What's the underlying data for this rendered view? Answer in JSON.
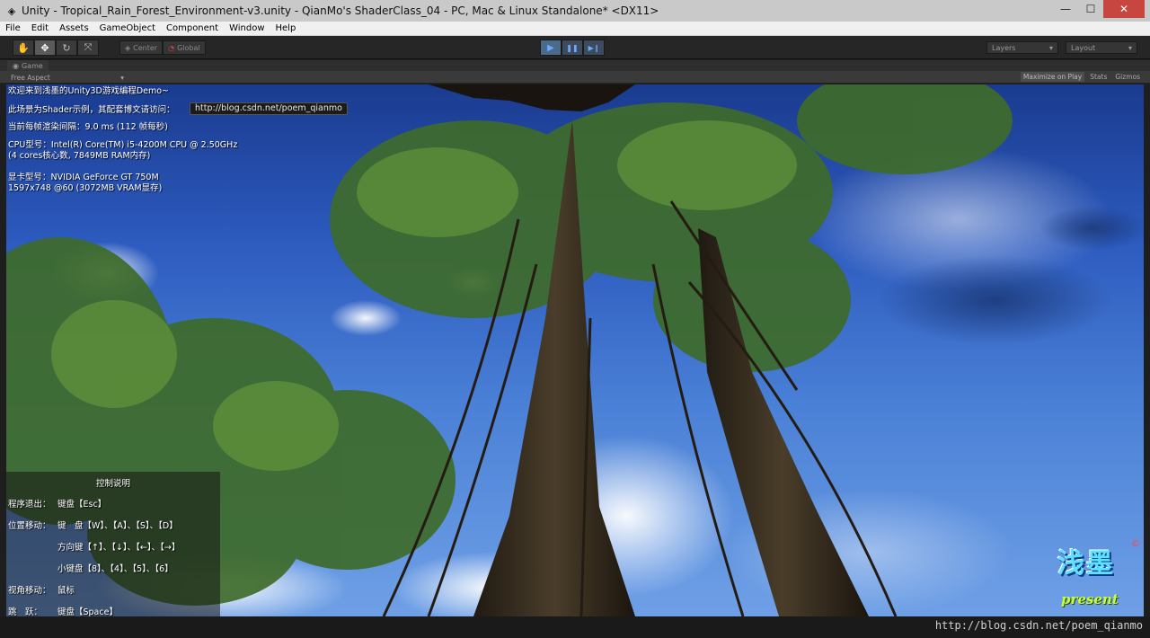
{
  "window": {
    "title": "Unity - Tropical_Rain_Forest_Environment-v3.unity - QianMo's ShaderClass_04 - PC, Mac & Linux Standalone* <DX11>",
    "controls": {
      "minimize": "—",
      "maximize": "☐",
      "close": "✕"
    }
  },
  "menu": [
    "File",
    "Edit",
    "Assets",
    "GameObject",
    "Component",
    "Window",
    "Help"
  ],
  "toolbar": {
    "transform_tools": [
      "hand-icon",
      "move-icon",
      "rotate-icon",
      "scale-icon"
    ],
    "pivot": {
      "center": "Center",
      "global": "Global"
    },
    "playback": {
      "play": "▶",
      "pause": "❚❚",
      "step": "▶❙"
    },
    "layers": "Layers",
    "layout": "Layout"
  },
  "game_panel": {
    "tab_label": "Game",
    "aspect": "Free Aspect",
    "maximize_on_play": "Maximize on Play",
    "stats": "Stats",
    "gizmos": "Gizmos"
  },
  "hud": {
    "welcome": "欢迎来到浅墨的Unity3D游戏编程Demo~",
    "shader_intro": "此场景为Shader示例，其配套博文请访问：",
    "url": "http://blog.csdn.net/poem_qianmo",
    "frame_time": "当前每帧渲染间隔：9.0 ms (112 帧每秒)",
    "cpu_line1": "CPU型号：Intel(R) Core(TM) i5-4200M CPU @ 2.50GHz",
    "cpu_line2": "(4 cores核心数, 7849MB RAM内存)",
    "gpu_line1": "显卡型号：NVIDIA GeForce GT 750M",
    "gpu_line2": "1597x748 @60 (3072MB VRAM显存)"
  },
  "controls_help": {
    "title": "控制说明",
    "rows": [
      {
        "label": "程序退出：",
        "value": "键盘【Esc】"
      },
      {
        "label": "位置移动：",
        "value": "键　盘【W】、【A】、【S】、【D】"
      },
      {
        "label": "",
        "value": "方向键【↑】、【↓】、【←】、【→】"
      },
      {
        "label": "",
        "value": "小键盘【8】、【4】、【5】、【6】"
      },
      {
        "label": "视角移动：",
        "value": "鼠标"
      },
      {
        "label": "跳　跃：",
        "value": "键盘【Space】"
      }
    ]
  },
  "logo": {
    "brand": "浅墨",
    "sub": "present",
    "mark": "©"
  },
  "watermark": "http://blog.csdn.net/poem_qianmo",
  "colors": {
    "sky_top": "#1a3b8f",
    "sky_bottom": "#6fa0e6",
    "foliage": "#3e6b2a",
    "trunk": "#3a2f22"
  }
}
